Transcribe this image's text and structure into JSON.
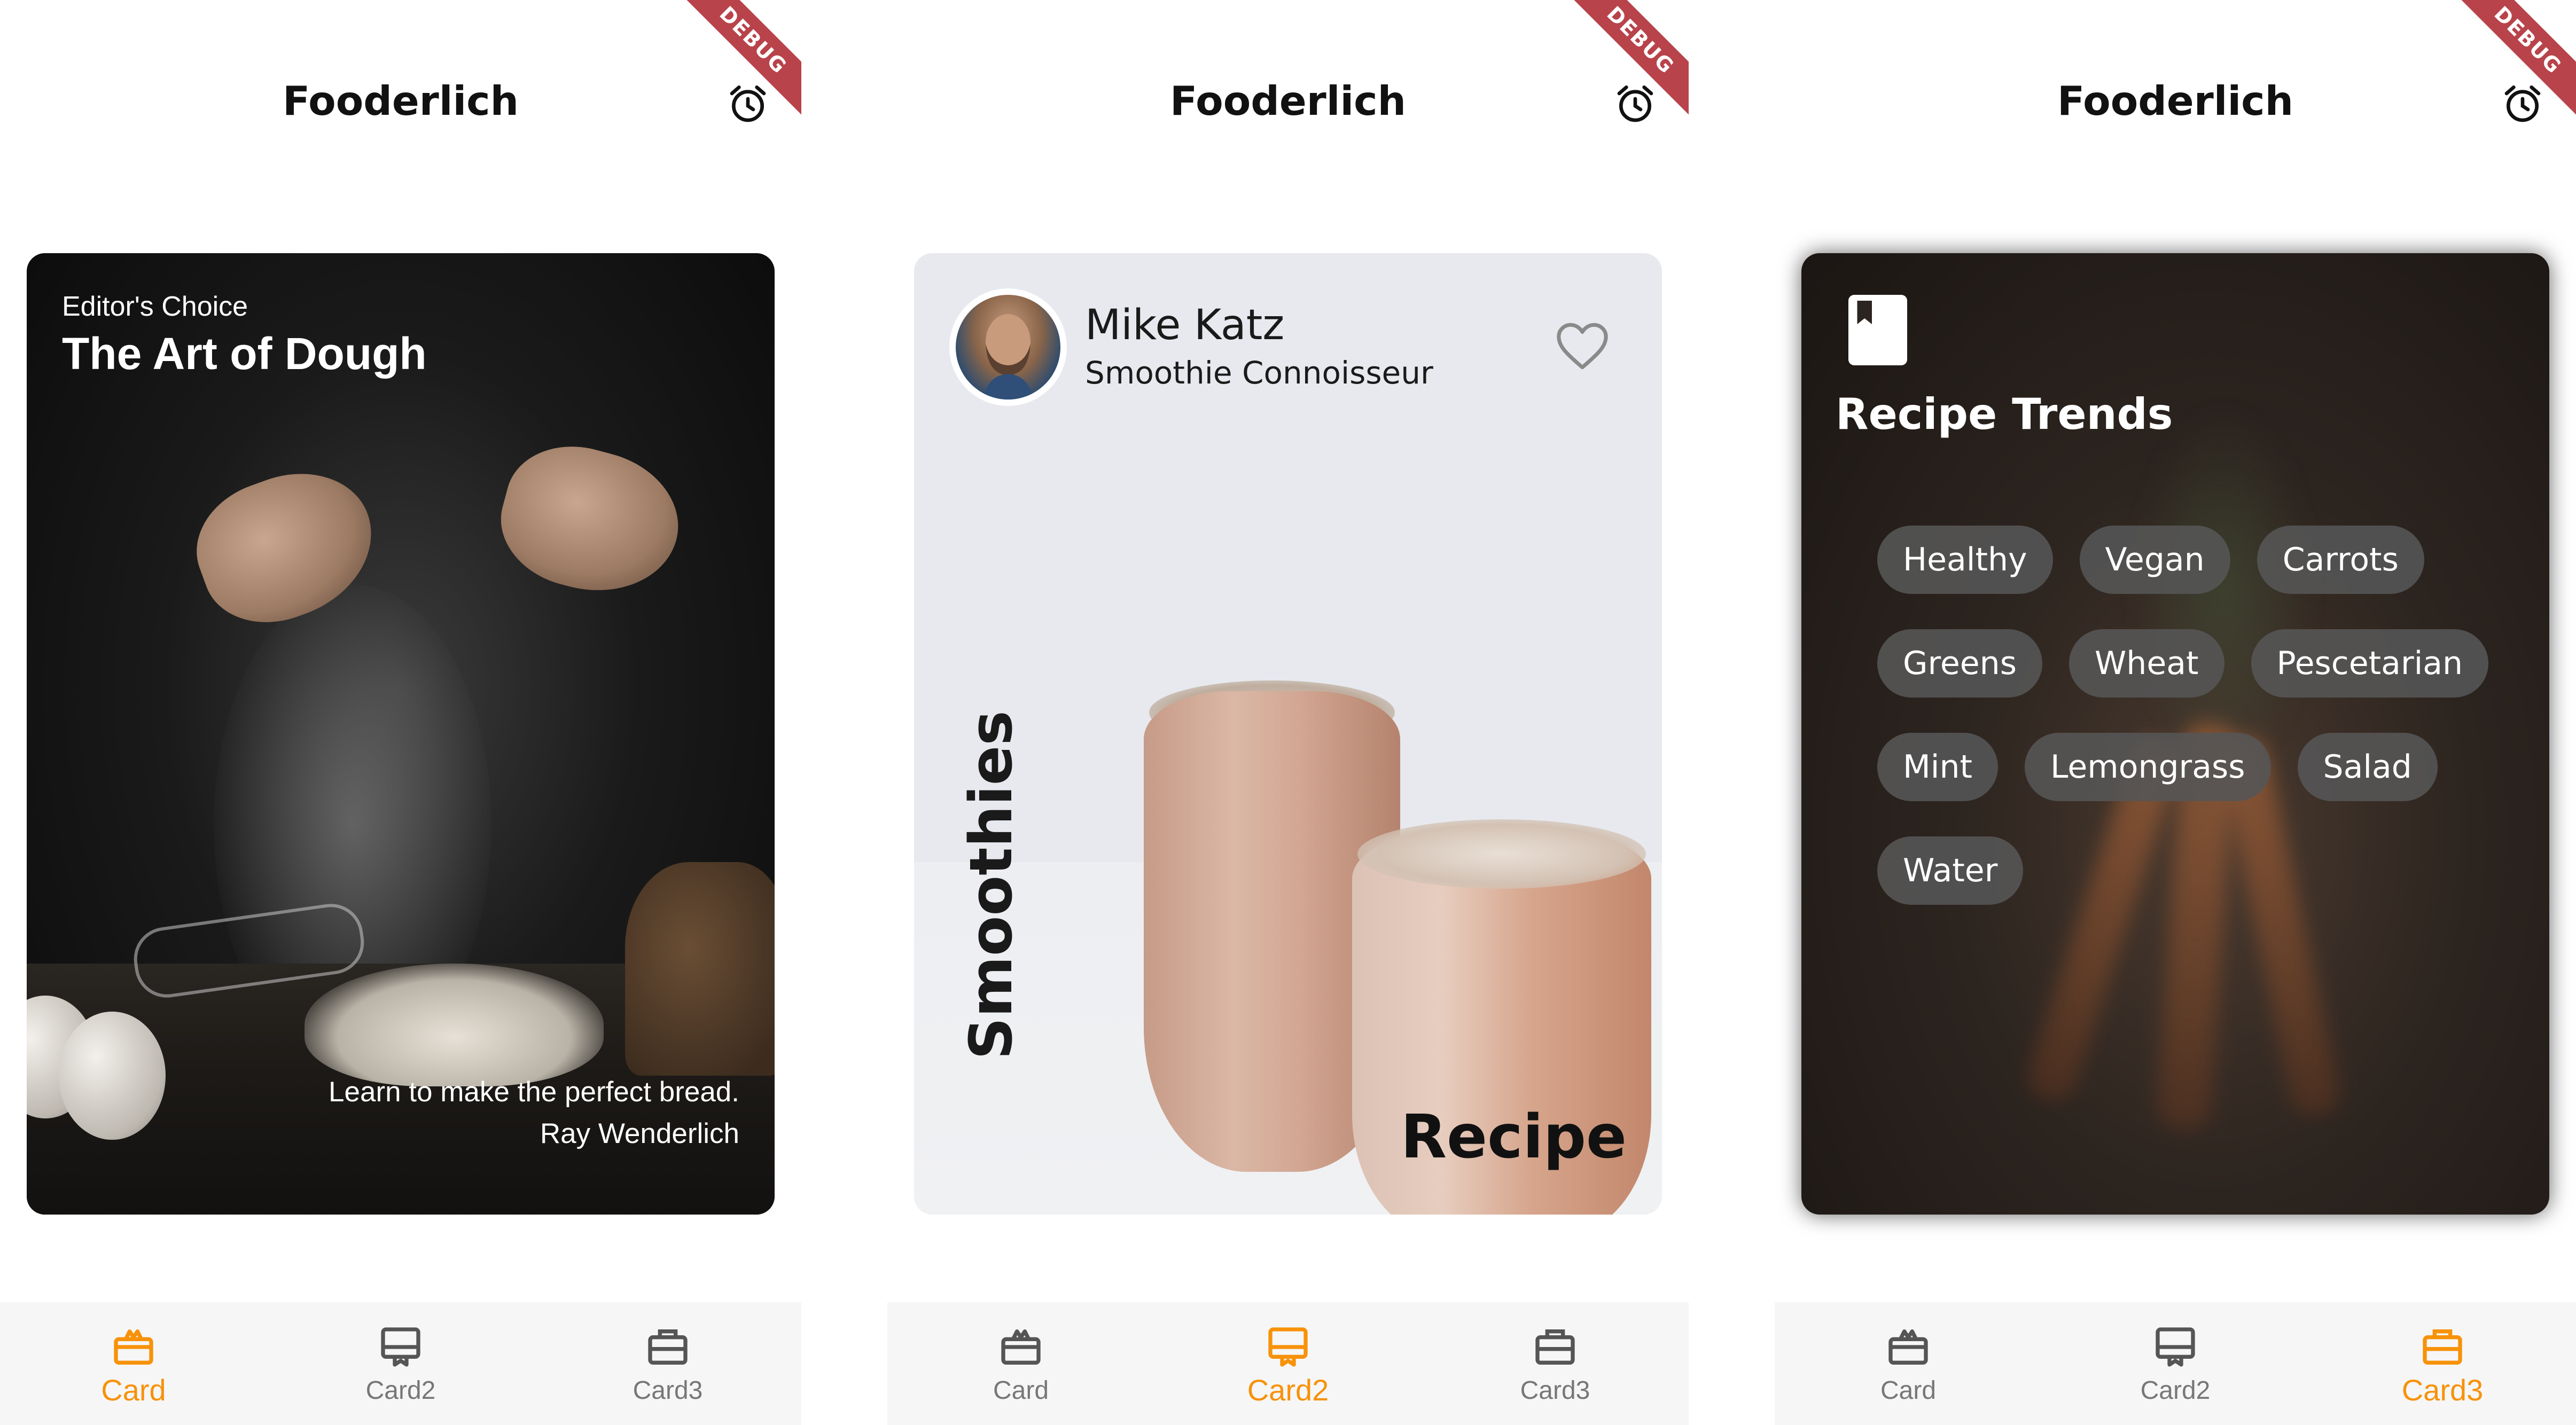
{
  "app": {
    "title": "Fooderlich",
    "debug_banner": "DEBUG"
  },
  "colors": {
    "active_tab": "#f7920a",
    "inactive_tab": "#777777",
    "debug_banner": "#b8434a"
  },
  "bottom_nav": {
    "items": [
      {
        "label": "Card",
        "icon": "card-icon"
      },
      {
        "label": "Card2",
        "icon": "card2-icon"
      },
      {
        "label": "Card3",
        "icon": "card3-icon"
      }
    ]
  },
  "screens": [
    {
      "active_tab": "Card",
      "card": {
        "subtitle": "Editor's Choice",
        "title": "The Art of Dough",
        "description": "Learn to make the perfect bread.",
        "author": "Ray Wenderlich"
      }
    },
    {
      "active_tab": "Card2",
      "card": {
        "author_name": "Mike Katz",
        "author_title": "Smoothie Connoisseur",
        "category": "Smoothies",
        "label": "Recipe",
        "favorite_icon": "heart-outline-icon"
      }
    },
    {
      "active_tab": "Card3",
      "card": {
        "icon": "book-icon",
        "title": "Recipe Trends",
        "tags": [
          "Healthy",
          "Vegan",
          "Carrots",
          "Greens",
          "Wheat",
          "Pescetarian",
          "Mint",
          "Lemongrass",
          "Salad",
          "Water"
        ]
      }
    }
  ]
}
